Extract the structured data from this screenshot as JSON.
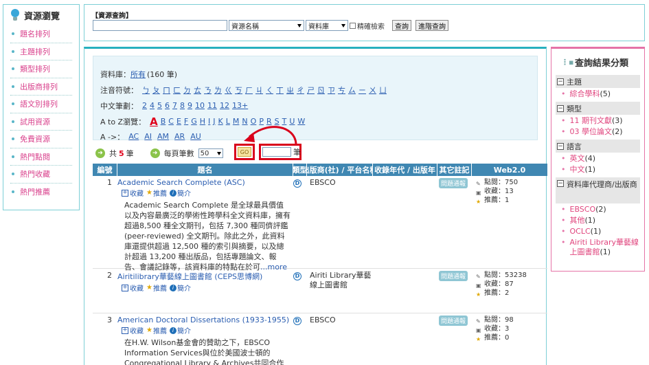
{
  "sidebar": {
    "title": "資源瀏覽",
    "items": [
      "題名排列",
      "主題排列",
      "類型排列",
      "出版商排列",
      "語文別排列",
      "試用資源",
      "免費資源",
      "熱門點閱",
      "熱門收藏",
      "熱門推薦"
    ]
  },
  "search": {
    "label": "【資源查詢】",
    "field_value": "資源名稱",
    "scope_value": "資料庫",
    "exact_label": "精確檢索",
    "query_button": "查詢",
    "advanced_button": "進階查詢"
  },
  "filters": {
    "db_label": "資料庫：",
    "db_link": "所有",
    "db_count": "(160 筆)",
    "zhuyin_label": "注音符號：",
    "zhuyin": [
      "ㄅ",
      "ㄆ",
      "ㄇ",
      "ㄈ",
      "ㄉ",
      "ㄊ",
      "ㄋ",
      "ㄌ",
      "ㄍ",
      "ㄎ",
      "ㄏ",
      "ㄐ",
      "ㄑ",
      "ㄒ",
      "ㄓ",
      "ㄔ",
      "ㄕ",
      "ㄖ",
      "ㄗ",
      "ㄘ",
      "ㄙ",
      "ㄧ",
      "ㄨ",
      "ㄩ"
    ],
    "strokes_label": "中文筆劃：",
    "strokes": [
      "2",
      "4",
      "5",
      "6",
      "7",
      "8",
      "9",
      "10",
      "11",
      "12",
      "13+"
    ],
    "az_label": "A to Z瀏覽：",
    "az_current": "A",
    "az": [
      "B",
      "C",
      "E",
      "F",
      "G",
      "H",
      "I",
      "J",
      "K",
      "L",
      "M",
      "N",
      "O",
      "P",
      "R",
      "S",
      "T",
      "U",
      "W"
    ],
    "arrow_label": "A ->：",
    "a_sub": [
      "AC",
      "AI",
      "AM",
      "AR",
      "AU"
    ]
  },
  "paging": {
    "total_prefix": "共",
    "total": "5",
    "total_suffix": "筆",
    "per_page_label": "每頁筆數",
    "per_page_value": "50",
    "go_label": "GO",
    "page_unit": "筆"
  },
  "table": {
    "headers": [
      "編號",
      "題名",
      "類型",
      "出版商(社) / 平台名稱",
      "收錄年代 / 出版年",
      "其它註記",
      "Web2.0"
    ],
    "action_collect": "收藏",
    "action_recommend": "推薦",
    "action_intro": "簡介",
    "type_icon": "D",
    "stat_labels": {
      "views": "點閱：",
      "collects": "收藏：",
      "recommends": "推薦："
    },
    "rows": [
      {
        "num": "1",
        "title": "Academic Search Complete (ASC)",
        "desc": "Academic Search Complete 是全球最具價值以及內容最廣泛的學術性跨學科全文資料庫，擁有超過8,500 種全文期刊，包括 7,300 種同儕評鑑 (peer-reviewed) 全文期刊。除此之外，此資料庫還提供超過 12,500 種的索引與摘要，以及總計超過 13,200 種出版品，包括專題論文、報告、會議記錄等，該資料庫的特點在於可",
        "more": "...more",
        "publisher": "EBSCO",
        "note": "問題通報",
        "views": "750",
        "collects": "13",
        "recommends": "1"
      },
      {
        "num": "2",
        "title": "Airitilibrary華藝線上圖書館 (CEPS思博網)",
        "desc": "",
        "more": "",
        "publisher": "Airiti Library華藝線上圖書館",
        "note": "問題通報",
        "views": "53238",
        "collects": "87",
        "recommends": "2"
      },
      {
        "num": "3",
        "title": "American Doctoral Dissertations (1933-1955)",
        "desc": "在H.W. Wilson基金會的贊助之下，EBSCO Information Services與位於美國波士頓的Congregational Library & Archives共同合作將原",
        "more": "",
        "publisher": "EBSCO",
        "note": "問題通報",
        "views": "98",
        "collects": "3",
        "recommends": "0"
      }
    ]
  },
  "facets": {
    "title": "查詢結果分類",
    "groups": [
      {
        "name": "主題",
        "items": [
          {
            "label": "綜合學科",
            "count": "(5)"
          }
        ]
      },
      {
        "name": "類型",
        "items": [
          {
            "label": "11 期刊文獻",
            "count": "(3)"
          },
          {
            "label": "03 學位論文",
            "count": "(2)"
          }
        ]
      },
      {
        "name": "語言",
        "items": [
          {
            "label": "英文",
            "count": "(4)"
          },
          {
            "label": "中文",
            "count": "(1)"
          }
        ]
      },
      {
        "name": "資料庫代理商/出版商",
        "items": [
          {
            "label": "EBSCO",
            "count": "(2)"
          },
          {
            "label": "其他",
            "count": "(1)"
          },
          {
            "label": "OCLC",
            "count": "(1)"
          },
          {
            "label": "Airiti Library華藝線上圖書館",
            "count": "(1)"
          }
        ]
      }
    ]
  },
  "colors": {
    "accent": "#26b0be",
    "header_bg": "#3f87b2",
    "pink": "#e573a7",
    "highlight": "#d9001b"
  }
}
